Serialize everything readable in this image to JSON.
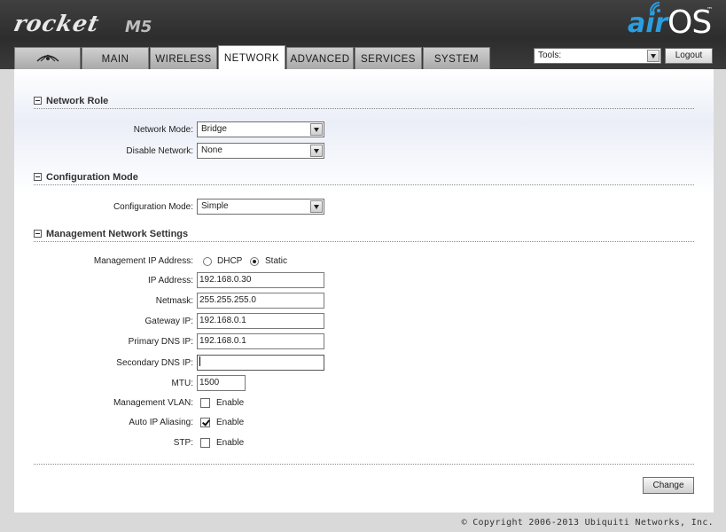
{
  "header": {
    "brand_name": "rocket",
    "model": "M5",
    "os_logo_air": "air",
    "os_logo_os": "OS",
    "os_logo_tm": "™"
  },
  "tabs": [
    {
      "label": "",
      "icon": "ubiquiti-logo-icon"
    },
    {
      "label": "MAIN"
    },
    {
      "label": "WIRELESS"
    },
    {
      "label": "NETWORK",
      "active": true
    },
    {
      "label": "ADVANCED"
    },
    {
      "label": "SERVICES"
    },
    {
      "label": "SYSTEM"
    }
  ],
  "tools": {
    "selected": "Tools:",
    "logout_label": "Logout"
  },
  "network_role": {
    "title": "Network Role",
    "network_mode_label": "Network Mode:",
    "network_mode_value": "Bridge",
    "disable_network_label": "Disable Network:",
    "disable_network_value": "None"
  },
  "configuration_mode": {
    "title": "Configuration Mode",
    "label": "Configuration Mode:",
    "value": "Simple"
  },
  "management": {
    "title": "Management Network Settings",
    "ip_mode_label": "Management IP Address:",
    "dhcp_label": "DHCP",
    "static_label": "Static",
    "ip_mode_selected": "Static",
    "ip_label": "IP Address:",
    "ip_value": "192.168.0.30",
    "netmask_label": "Netmask:",
    "netmask_value": "255.255.255.0",
    "gateway_label": "Gateway IP:",
    "gateway_value": "192.168.0.1",
    "primary_dns_label": "Primary DNS IP:",
    "primary_dns_value": "192.168.0.1",
    "secondary_dns_label": "Secondary DNS IP:",
    "secondary_dns_value": "",
    "mtu_label": "MTU:",
    "mtu_value": "1500",
    "vlan_label": "Management VLAN:",
    "vlan_enabled": false,
    "alias_label": "Auto IP Aliasing:",
    "alias_enabled": true,
    "stp_label": "STP:",
    "stp_enabled": false,
    "enable_label": "Enable"
  },
  "actions": {
    "change_label": "Change"
  },
  "footer": {
    "copyright": "© Copyright 2006-2013 Ubiquiti Networks, Inc."
  },
  "colors": {
    "header_bg": "#333333",
    "air_blue": "#2a9ee0",
    "content_bg": "#ffffff"
  }
}
